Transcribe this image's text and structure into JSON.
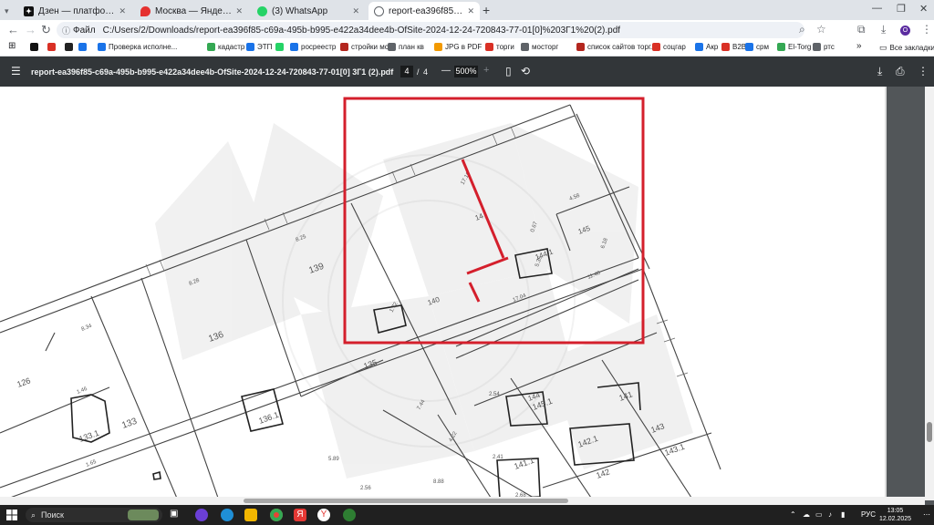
{
  "browser": {
    "tabs": [
      {
        "label": "Дзен — платформа для прос...",
        "icon": "zen-icon",
        "color": "#111111",
        "active": false
      },
      {
        "label": "Москва — Яндекс Карты",
        "icon": "map-pin-icon",
        "color": "#e5312f",
        "active": false
      },
      {
        "label": "(3) WhatsApp",
        "icon": "whatsapp-icon",
        "color": "#25d366",
        "active": false
      },
      {
        "label": "report-ea396f85-c69a-495b-b9...",
        "icon": "globe-icon",
        "color": "#5f6368",
        "active": true
      }
    ],
    "address": {
      "file_label": "Файл",
      "url": "C:/Users/2/Downloads/report-ea396f85-c69a-495b-b995-e422a34dee4b-OfSite-2024-12-24-720843-77-01[0]%203Г1%20(2).pdf"
    },
    "bookmarks": [
      {
        "label": "",
        "color": "#111111"
      },
      {
        "label": "",
        "color": "#d93025"
      },
      {
        "label": "",
        "color": "#222222"
      },
      {
        "label": "",
        "color": "#1a73e8"
      },
      {
        "label": "Проверка исполне...",
        "color": "#1a73e8"
      },
      {
        "label": "кадастр он",
        "color": "#34a853"
      },
      {
        "label": "ЭТП",
        "color": "#1a73e8"
      },
      {
        "label": "",
        "color": "#25d366"
      },
      {
        "label": "росреестр",
        "color": "#1a73e8"
      },
      {
        "label": "стройки мск",
        "color": "#b3261e"
      },
      {
        "label": "план кв",
        "color": "#5f6368"
      },
      {
        "label": "JPG в PDF",
        "color": "#f29900"
      },
      {
        "label": "торги",
        "color": "#d93025"
      },
      {
        "label": "мосторг",
        "color": "#5f6368"
      },
      {
        "label": "список сайтов торг...",
        "color": "#b3261e"
      },
      {
        "label": "соцгар",
        "color": "#d93025"
      },
      {
        "label": "Акр",
        "color": "#1a73e8"
      },
      {
        "label": "B2B",
        "color": "#d93025"
      },
      {
        "label": "срм",
        "color": "#1a73e8"
      },
      {
        "label": "El-Torg",
        "color": "#34a853"
      },
      {
        "label": "ртс",
        "color": "#5f6368"
      }
    ],
    "all_bookmarks": "Все закладки",
    "profile_letter": "O"
  },
  "pdf": {
    "title": "report-ea396f85-c69a-495b-b995-e422a34dee4b-OfSite-2024-12-24-720843-77-01[0] 3Г1 (2).pdf",
    "current_page": "4",
    "separator": "/",
    "total_pages": "4",
    "zoom": "500%",
    "minus": "—",
    "plus": "+"
  },
  "plan": {
    "room_numbers": [
      "139",
      "136",
      "126",
      "133",
      "133.1",
      "136.1",
      "135",
      "145.1",
      "141",
      "141.1",
      "143",
      "143.1",
      "142",
      "142.1",
      "144",
      "144.1",
      "14",
      "145",
      "140"
    ],
    "dimensions": [
      "8.25",
      "8.28",
      "8.34",
      "5.89",
      "8.88",
      "4.22",
      "7.44",
      "2.41",
      "2.68",
      "11.40",
      "17.04",
      "4.58",
      "2.54",
      "1.65",
      "1.46",
      "5.35",
      "0.67",
      "6.18",
      "1.72",
      "17.10",
      "2.56"
    ]
  },
  "taskbar": {
    "search_placeholder": "Поиск",
    "language": "РУС",
    "time": "13:05",
    "date": "12.02.2025"
  }
}
